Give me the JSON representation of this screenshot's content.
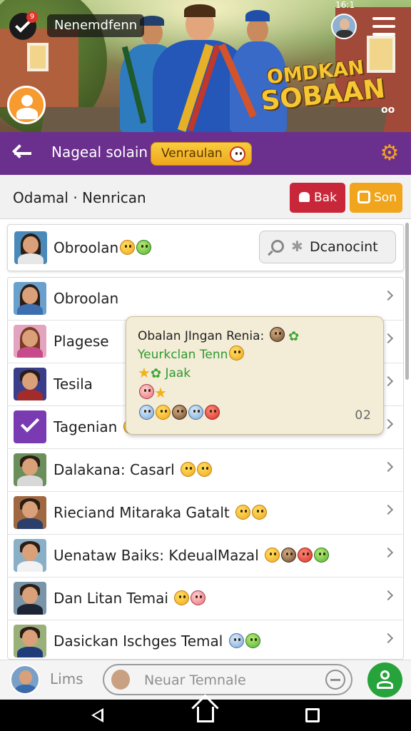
{
  "status_bar": {
    "time": "16:1"
  },
  "banner": {
    "app_name": "Nenemdfenn",
    "notification_count": "9",
    "title_line1": "OMDKAN",
    "title_line2": "SOBAAN",
    "glasses_icon": "oo"
  },
  "header": {
    "title": "Nageal solain",
    "pill_label": "Venraulan"
  },
  "subheader": {
    "title": "Odamal · Nenrican",
    "bak_label": "Bak",
    "son_label": "Son"
  },
  "pinned": {
    "name": "Obroolan",
    "search_value": "Dcanocint"
  },
  "list": {
    "items": [
      {
        "label": "Obroolan"
      },
      {
        "label": "Plagese"
      },
      {
        "label": "Tesila"
      },
      {
        "label": "Tagenian"
      },
      {
        "label": "Dalakana: Casarl"
      },
      {
        "label": "Rieciand Mitaraka Gatalt"
      },
      {
        "label": "Uenataw Baiks: KdeualMazal"
      },
      {
        "label": "Dan Litan Temai"
      },
      {
        "label": "Dasickan Ischges Temal"
      }
    ]
  },
  "popup": {
    "line1": "Obalan JIngan Renia:",
    "line2": "Yeurkclan Tenn",
    "line3": "Jaak",
    "count": "02"
  },
  "composer": {
    "user_name": "Lims",
    "placeholder": "Neuar Temnale"
  },
  "colors": {
    "purple": "#6b2f8e",
    "bak_red": "#c8273a",
    "son_orange": "#f0a51d",
    "send_green": "#26a33b"
  }
}
